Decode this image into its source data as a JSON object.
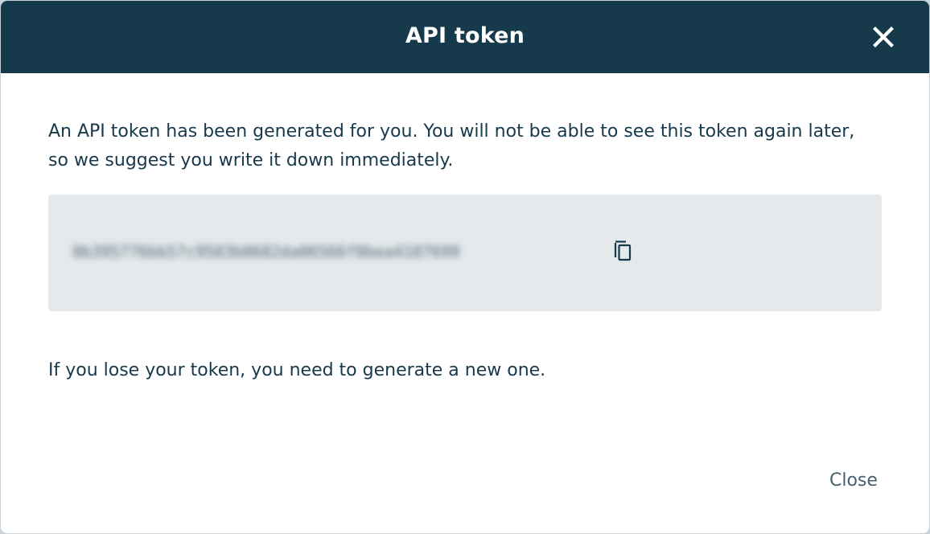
{
  "dialog": {
    "title": "API token",
    "close_icon": "close-icon",
    "intro": "An API token has been generated for you. You will not be able to see this token again later, so we suggest you write it down immediately.",
    "token": {
      "value": "0b395776bb57c9503b0682da06566f0bea4107699",
      "copy_icon": "copy-icon"
    },
    "note": "If you lose your token, you need to generate a new one.",
    "close_label": "Close"
  },
  "colors": {
    "header_bg": "#17394c",
    "text": "#17394c",
    "token_bg": "#e5e9ec",
    "close_text": "#45606e"
  }
}
